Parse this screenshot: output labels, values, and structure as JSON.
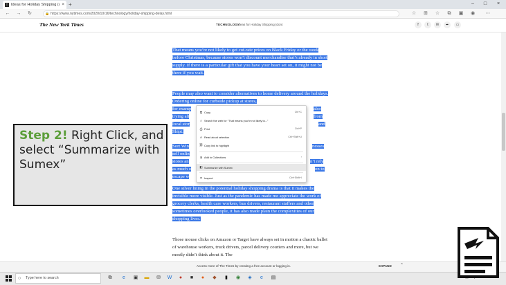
{
  "browser": {
    "tab_title": "Ideas for Holiday Shipping (dont",
    "tab_favicon": "T",
    "new_tab_label": "+",
    "window_controls": [
      "–",
      "□",
      "×"
    ],
    "url": "https://www.nytimes.com/2020/10/16/technology/holiday-shipping-delay.html"
  },
  "nyt": {
    "logo": "The New York Times",
    "section": "TECHNOLOGY",
    "headline": "Ideas for Holiday Shipping (dont"
  },
  "article": {
    "p1": "That means you’re not likely to get cut-rate prices on Black Friday or the week before Christmas, because stores won’t discount merchandise that’s already in short supply. If there is a particular gift that you have your heart set on, it might not be there if you wait.",
    "p2a": "People may also want to consider alternatives to home delivery around the holidays. Ordering online for curbside pickup at stores,",
    "p2b": "for examp",
    "p2b_r": "also",
    "p2c": "trying ali",
    "p2c_r": "from",
    "p2d": "local stor",
    "p2d_r": "and",
    "p2e": "Shipt.",
    "p3a": "Sort Win",
    "p3a_r": "nesses",
    "p3b": "sell onlin",
    "p3b_r": "",
    "p3c": "stores an",
    "p3c_r": "n’t rely",
    "p3d": "as much o",
    "p3d_r": "on to",
    "p3e": "escape w",
    "p4": "One silver lining in the potential holiday shopping drama is that it makes the invisible more visible. Just as the pandemic has made me appreciate the work of grocery clerks, health care workers, bus drivers, restaurant staffers and other sometimes overlooked people, it has also made plain the complexities of our shopping lives.",
    "p5": "Those mouse clicks on Amazon or Target have always set in motion a chaotic ballet of warehouse workers, truck drivers, parcel delivery couriers and more, but we mostly didn’t think about it. The"
  },
  "context_menu": {
    "items": [
      {
        "label": "Copy",
        "shortcut": "Ctrl+C",
        "icon": "copy-icon"
      },
      {
        "label": "Search the web for “That means you’re not likely to...”",
        "shortcut": "",
        "icon": "search-icon"
      },
      {
        "label": "Print",
        "shortcut": "Ctrl+P",
        "icon": "print-icon"
      },
      {
        "label": "Read aloud selection",
        "shortcut": "Ctrl+Shift+U",
        "icon": "read-aloud-icon"
      },
      {
        "label": "Copy link to highlight",
        "shortcut": "",
        "icon": "link-icon"
      },
      {
        "label": "Add to Collections",
        "shortcut": "",
        "icon": "collections-icon"
      },
      {
        "label": "Summarize with Sumex",
        "shortcut": "",
        "icon": "sumex-icon"
      },
      {
        "label": "Inspect",
        "shortcut": "Ctrl+Shift+I",
        "icon": "inspect-icon"
      }
    ]
  },
  "callout": {
    "step": "Step 2!",
    "text": " Right Click, and select “Summarize with Sumex”"
  },
  "promo": {
    "text": "Access more of The Times by creating a free account or logging in.",
    "link": "EXPAND"
  },
  "taskbar": {
    "search_placeholder": "Type here to search"
  },
  "colors": {
    "selection": "#3b78e7",
    "step_green": "#5c9e3a",
    "callout_bg": "#e6e6e6"
  }
}
